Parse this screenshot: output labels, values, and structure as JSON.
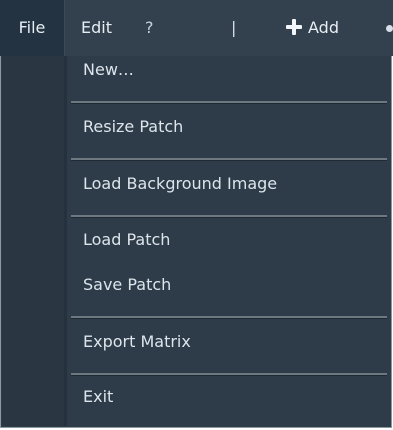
{
  "menubar": {
    "file": "File",
    "edit": "Edit",
    "help": "?",
    "separator": "|",
    "add": "Add"
  },
  "file_menu": {
    "items": [
      "New…",
      "Resize Patch",
      "Load Background Image",
      "Load Patch",
      "Save Patch",
      "Export Matrix",
      "Exit"
    ]
  },
  "colors": {
    "menubar": "#33414e",
    "dropdown": "#2e3b48",
    "text": "#dde5ec"
  }
}
